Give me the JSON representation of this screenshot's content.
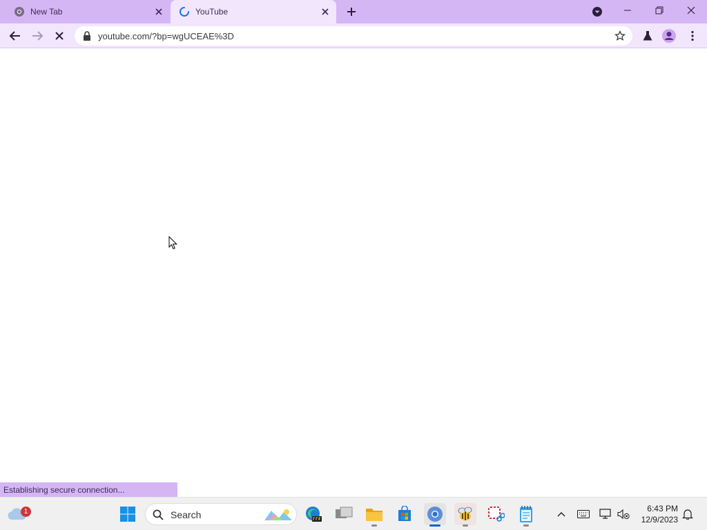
{
  "browser": {
    "tabs": [
      {
        "title": "New Tab",
        "active": false
      },
      {
        "title": "YouTube",
        "active": true
      }
    ],
    "address": {
      "url": "youtube.com/?bp=wgUCEAE%3D"
    },
    "status_text": "Establishing secure connection..."
  },
  "taskbar": {
    "search_label": "Search",
    "weather_badge": "1",
    "time": "6:43 PM",
    "date": "12/9/2023"
  },
  "colors": {
    "tabstrip": "#d5b6f5",
    "toolbar": "#f1e6fc",
    "accent": "#0a63c9"
  },
  "icons": {
    "tab1_favicon": "chrome-icon",
    "tab2_favicon": "loading-spinner-icon",
    "taskbar_apps": [
      "start-icon",
      "edge-beta-icon",
      "task-view-icon",
      "file-explorer-icon",
      "microsoft-store-icon",
      "chrome-icon",
      "bee-app-icon",
      "snipping-tool-icon",
      "notepad-icon"
    ]
  }
}
